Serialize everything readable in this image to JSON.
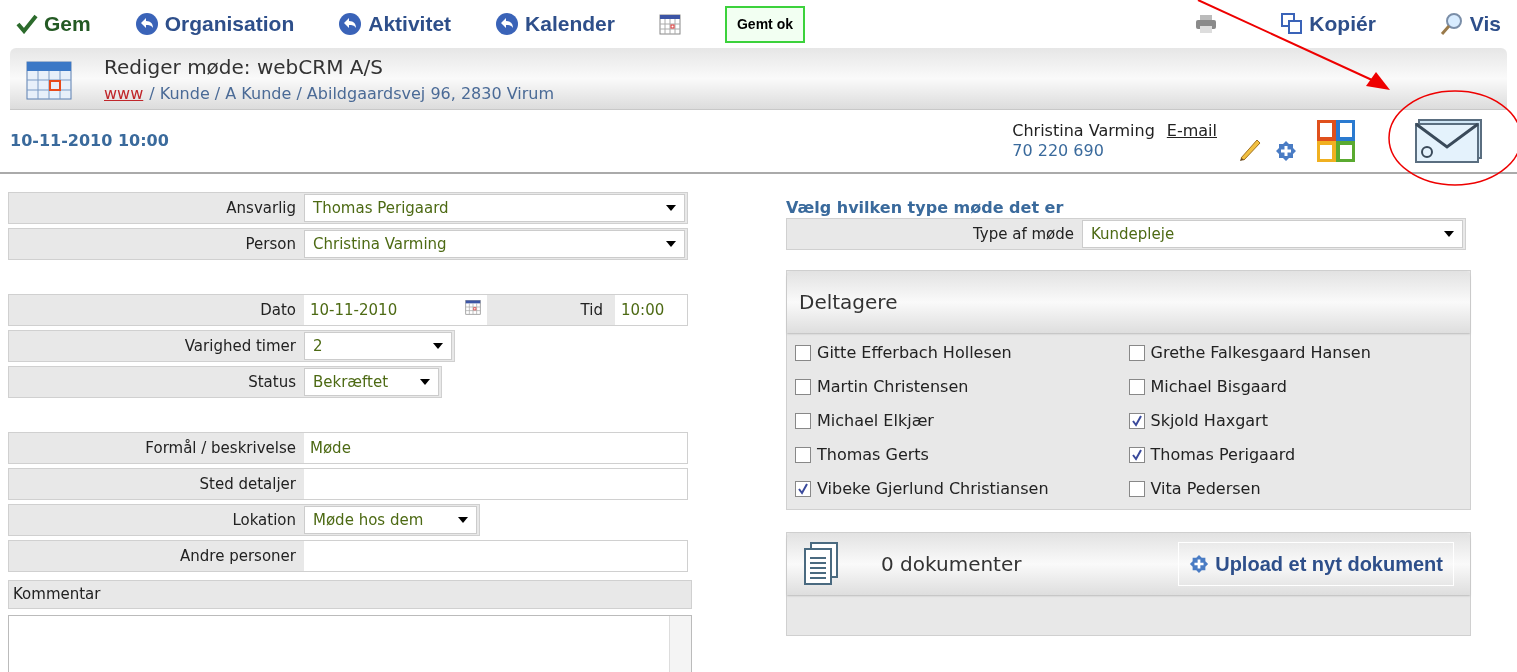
{
  "toolbar": {
    "left": [
      {
        "kind": "check",
        "label": "Gem"
      },
      {
        "kind": "back",
        "label": "Organisation"
      },
      {
        "kind": "back",
        "label": "Aktivitet"
      },
      {
        "kind": "back",
        "label": "Kalender"
      },
      {
        "kind": "calendar"
      },
      {
        "kind": "status",
        "label": "Gemt ok"
      }
    ],
    "right": [
      {
        "kind": "print"
      },
      {
        "kind": "copy",
        "label": "Kopiér"
      },
      {
        "kind": "search",
        "label": "Vis"
      }
    ]
  },
  "header": {
    "title": "Rediger møde: webCRM A/S",
    "breadcrumb_link": "www",
    "breadcrumb_path": "/ Kunde / A Kunde / Abildgaardsvej 96, 2830 Virum"
  },
  "datetime": "10-11-2010 10:00",
  "contact": {
    "name": "Christina Varming",
    "email": "E-mail",
    "phone": "70 220 690"
  },
  "form_groups": [
    [
      {
        "kind": "select",
        "label": "Ansvarlig",
        "value": "Thomas Perigaard"
      },
      {
        "kind": "select",
        "label": "Person",
        "value": "Christina Varming"
      }
    ],
    [
      {
        "kind": "datetime",
        "label": "Dato",
        "value": "10-11-2010",
        "time_label": "Tid",
        "time_value": "10:00"
      },
      {
        "kind": "select",
        "label": "Varighed timer",
        "value": "2"
      },
      {
        "kind": "select",
        "label": "Status",
        "value": "Bekræftet"
      }
    ],
    [
      {
        "kind": "input",
        "label": "Formål / beskrivelse",
        "value": "Møde"
      },
      {
        "kind": "input",
        "label": "Sted detaljer"
      },
      {
        "kind": "select",
        "label": "Lokation",
        "value": "Møde hos dem"
      },
      {
        "kind": "input",
        "label": "Andre personer"
      }
    ]
  ],
  "comment": {
    "label": "Kommentar"
  },
  "meeting_type": {
    "heading": "Vælg hvilken type møde det er",
    "label": "Type af møde",
    "value": "Kundepleje"
  },
  "participants": {
    "title": "Deltagere",
    "items": [
      {
        "name": "Gitte Efferbach Hollesen",
        "checked": false
      },
      {
        "name": "Grethe Falkesgaard Hansen",
        "checked": false
      },
      {
        "name": "Martin Christensen",
        "checked": false
      },
      {
        "name": "Michael Bisgaard",
        "checked": false
      },
      {
        "name": "Michael Elkjær",
        "checked": false
      },
      {
        "name": "Skjold Haxgart",
        "checked": true
      },
      {
        "name": "Thomas Gerts",
        "checked": false
      },
      {
        "name": "Thomas Perigaard",
        "checked": true
      },
      {
        "name": "Vibeke Gjerlund Christiansen",
        "checked": true
      },
      {
        "name": "Vita Pedersen",
        "checked": false
      }
    ]
  },
  "documents": {
    "count": "0 dokumenter",
    "upload": "Upload et nyt dokument"
  }
}
